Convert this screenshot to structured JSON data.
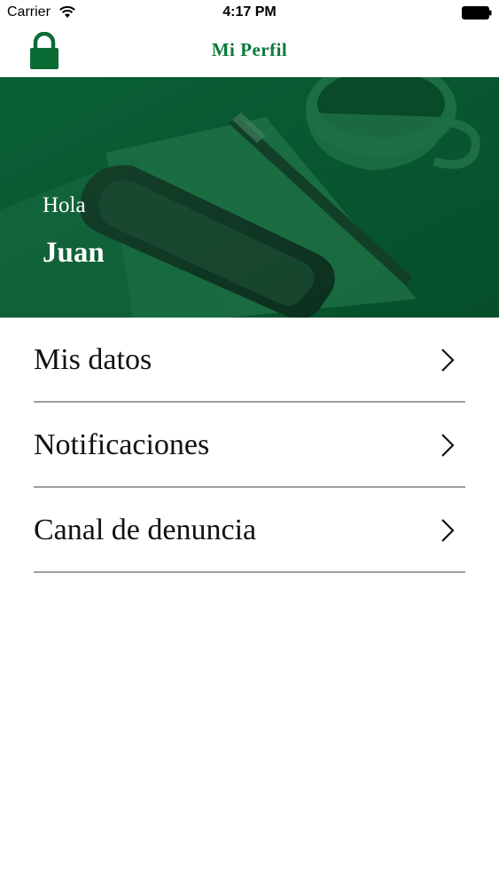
{
  "status_bar": {
    "carrier": "Carrier",
    "time": "4:17 PM",
    "wifi_icon": "wifi-icon",
    "battery_icon": "battery-icon"
  },
  "nav": {
    "title": "Mi Perfil",
    "left_icon": "lock-icon"
  },
  "hero": {
    "greeting": "Hola",
    "name": "Juan",
    "image": "phone-notebook-pen-coffee-cup photo with green tint"
  },
  "menu": {
    "items": [
      {
        "label": "Mis datos",
        "icon": "chevron-right-icon"
      },
      {
        "label": "Notificaciones",
        "icon": "chevron-right-icon"
      },
      {
        "label": "Canal de denuncia",
        "icon": "chevron-right-icon"
      }
    ]
  },
  "colors": {
    "accent": "#0b7a3a",
    "hero_tint": "#0a5a33",
    "divider": "#9e9e9e",
    "text": "#111111"
  }
}
